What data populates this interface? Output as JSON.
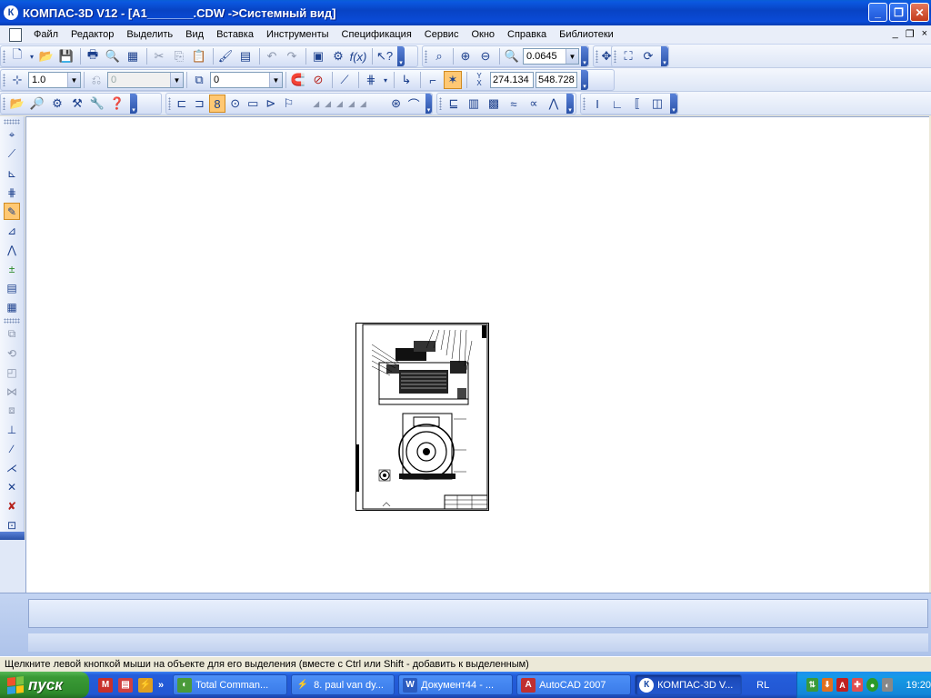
{
  "window": {
    "title": "КОМПАС-3D V12 - [A1_______.CDW ->Системный вид]",
    "app_icon_letter": "К",
    "controls": [
      "_",
      "❐",
      "✕"
    ]
  },
  "menu": {
    "items": [
      "Файл",
      "Редактор",
      "Выделить",
      "Вид",
      "Вставка",
      "Инструменты",
      "Спецификация",
      "Сервис",
      "Окно",
      "Справка",
      "Библиотеки"
    ],
    "mdi_controls": [
      "_",
      "❐",
      "×"
    ]
  },
  "toolbar1": {
    "zoom_value": "0.0645"
  },
  "toolbar2": {
    "step_value": "1.0",
    "layer_value": "0",
    "style_value": "0",
    "coord_y_label": "Y",
    "coord_x_label": "X",
    "coord_x": "274.134",
    "coord_y": "548.728"
  },
  "status": {
    "message": "Щелкните левой кнопкой мыши на объекте для его выделения (вместе с Ctrl или Shift - добавить к выделенным)"
  },
  "taskbar": {
    "start_label": "пуск",
    "tasks": [
      {
        "label": "Total Comman...",
        "icon": "total-commander-icon",
        "color": "#4a9a3a",
        "glyph": "◐"
      },
      {
        "label": "8. paul van dy...",
        "icon": "winamp-icon",
        "color": "#e0a020",
        "glyph": "⚡"
      },
      {
        "label": "Документ44 - ...",
        "icon": "word-icon",
        "color": "#2a5bc0",
        "glyph": "W"
      },
      {
        "label": "AutoCAD 2007",
        "icon": "autocad-icon",
        "color": "#c03030",
        "glyph": "A"
      },
      {
        "label": "КОМПАС-3D V...",
        "icon": "kompas-icon",
        "color": "#ffffff",
        "glyph": "К"
      }
    ],
    "language": "RL",
    "clock": "19:20"
  },
  "colors": {
    "title_bar": "#0a4bd8",
    "taskbar": "#245edb",
    "start_button": "#3a9a36",
    "canvas": "#ffffff"
  }
}
